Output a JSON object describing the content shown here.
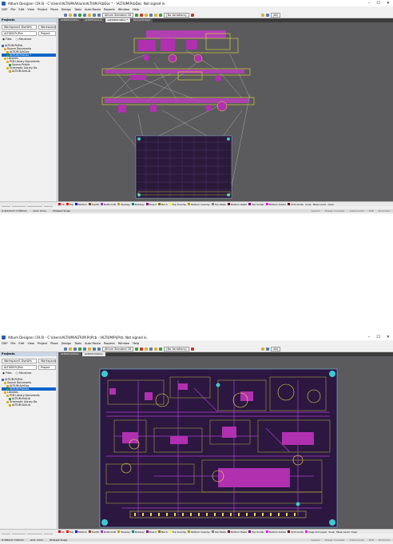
{
  "top": {
    "title": "Altium Designer (19.0) - C:\\Users\\ALTIUM\\Altium\\ALTIUM.PcbDoc * - \\ALTIUM\\PcbDoc. Not signed in.",
    "menu": [
      "DXP",
      "File",
      "Edit",
      "View",
      "Project",
      "Place",
      "Design",
      "Tools",
      "Auto Route",
      "Reports",
      "Window",
      "Help"
    ],
    "toolbar": {
      "standard": "Altium Standard 2D",
      "variations": "[No Variations]",
      "units": "(All)"
    },
    "projects_panel": {
      "title": "Projects",
      "workspace": "Workspace1.DsnWrk",
      "workspace_btn": "Workspace",
      "project": "ALTIUM.PrjPcb",
      "project_btn": "Project",
      "radio_files": "Files",
      "radio_structure": "Structure",
      "tree": [
        {
          "label": "ALTIUM.PrjPcb",
          "type": "project"
        },
        {
          "label": "Source Documents",
          "type": "folder"
        },
        {
          "label": "ALTIUM.SchDoc",
          "type": "sch"
        },
        {
          "label": "ALTIUM.PcbDoc *",
          "type": "pcb",
          "selected": true
        },
        {
          "label": "Libraries",
          "type": "folder"
        },
        {
          "label": "PCB Library Documents",
          "type": "folder"
        },
        {
          "label": "Source.PcbLib",
          "type": "lib"
        },
        {
          "label": "Schematic Library Do",
          "type": "folder"
        },
        {
          "label": "ALTIUM.SchLib",
          "type": "lib"
        }
      ]
    },
    "side_tabs": [
      "Files",
      "Projects",
      "Navigator",
      "PCB"
    ],
    "doc_tabs": [
      "ALTIUM.SchDoc",
      "ALTIUM.SchLib",
      "ALTIUM.PcbDoc *",
      "Source.PcbLib"
    ],
    "status": {
      "coords": "X:4115mm Y:705mm",
      "grid": "Grid: 1mm",
      "snap": "(Hotspot Snap)",
      "right": [
        "System",
        "Design Compiler",
        "Instruments",
        "PCB",
        "Shortcuts"
      ]
    }
  },
  "bottom": {
    "title": "Altium Designer (19.0) - C:\\Users\\ALTIUM\\ALTIUM.PrjPcb - \\ALTIUM\\PrjPcb. Not signed in.",
    "menu": [
      "DXP",
      "File",
      "Edit",
      "View",
      "Project",
      "Place",
      "Design",
      "Tools",
      "Auto Route",
      "Reports",
      "Window",
      "Help"
    ],
    "toolbar": {
      "standard": "Altium Standard 2D",
      "variations": "[No Variations]",
      "units": "(All)"
    },
    "projects_panel": {
      "title": "Projects",
      "workspace": "Workspace1.DsnWrk",
      "workspace_btn": "Workspace",
      "project": "ALTIUM.PrjPcb",
      "project_btn": "Project",
      "radio_files": "Files",
      "radio_structure": "Structure",
      "tree": [
        {
          "label": "ALTIUM.PrjPcb",
          "type": "project"
        },
        {
          "label": "Source Documents",
          "type": "folder"
        },
        {
          "label": "ALTIUM.SchDoc",
          "type": "sch"
        },
        {
          "label": "ALTIUM.PcbDoc",
          "type": "pcb",
          "selected": true
        },
        {
          "label": "Libraries",
          "type": "folder"
        },
        {
          "label": "PCB Library Documents",
          "type": "folder"
        },
        {
          "label": "ALTIUM.PcbLib",
          "type": "lib"
        },
        {
          "label": "Schematic Library Do",
          "type": "folder"
        },
        {
          "label": "ALTIUM.SchLib",
          "type": "lib"
        }
      ]
    },
    "side_tabs": [
      "Files",
      "Projects",
      "Navigator",
      "PCB"
    ],
    "doc_tabs": [
      "ALTIUM.SchDoc",
      "ALTIUM.PcbDoc"
    ],
    "status": {
      "coords": "X:296mm Y:90mm",
      "grid": "Grid: 1mm",
      "snap": "(Hotspot Snap)",
      "right": [
        "System",
        "Design Compiler",
        "Instruments",
        "PCB",
        "Shortcuts"
      ]
    }
  },
  "layers": [
    {
      "name": "LS",
      "color": "#d00000"
    },
    {
      "name": "Top",
      "color": "#ff0000"
    },
    {
      "name": "Bottom",
      "color": "#0000ff"
    },
    {
      "name": "Top3D",
      "color": "#8b4513"
    },
    {
      "name": "Bottom3D",
      "color": "#9932cc"
    },
    {
      "name": "Topassy",
      "color": "#c8a000"
    },
    {
      "name": "Botassy",
      "color": "#008080"
    },
    {
      "name": "Board",
      "color": "#800080"
    },
    {
      "name": "Mech",
      "color": "#808000"
    },
    {
      "name": "Top Overlay",
      "color": "#ffff00"
    },
    {
      "name": "Bottom Overlay",
      "color": "#a0a000"
    },
    {
      "name": "Top Paste",
      "color": "#808080"
    },
    {
      "name": "Bottom Paste",
      "color": "#800000"
    },
    {
      "name": "Top Solder",
      "color": "#800080"
    },
    {
      "name": "Bottom Solder",
      "color": "#ff00ff"
    },
    {
      "name": "Drill Guide",
      "color": "#800000"
    },
    {
      "name": "Keep-Out Layer",
      "color": "#ff00ff"
    }
  ],
  "layer_bar_right": [
    "Snap",
    "Mask Level",
    "Clear"
  ]
}
